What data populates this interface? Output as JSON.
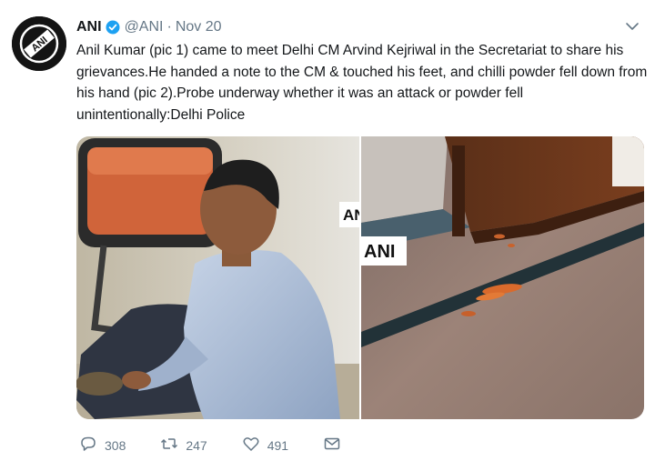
{
  "author": {
    "name": "ANI",
    "handle": "@ANI",
    "separator": "·",
    "date": "Nov 20",
    "avatar_logo_text": "ANI"
  },
  "tweet": {
    "text": "Anil Kumar (pic 1) came to meet Delhi CM Arvind Kejriwal in the Secretariat to share his grievances.He handed a note to the CM & touched his feet, and chilli powder fell down from his hand (pic 2).Probe underway whether it was an attack or powder fell unintentionally:Delhi Police"
  },
  "media": {
    "watermark_pic1": "AN",
    "watermark_pic2": "ANI"
  },
  "actions": {
    "replies": "308",
    "retweets": "247",
    "likes": "491"
  },
  "icons": {
    "verified": "verified-badge-icon",
    "caret": "chevron-down-icon",
    "reply": "reply-icon",
    "retweet": "retweet-icon",
    "like": "heart-icon",
    "dm": "envelope-icon"
  },
  "colors": {
    "verified": "#1da1f2",
    "meta_text": "#657786",
    "text": "#14171a"
  }
}
